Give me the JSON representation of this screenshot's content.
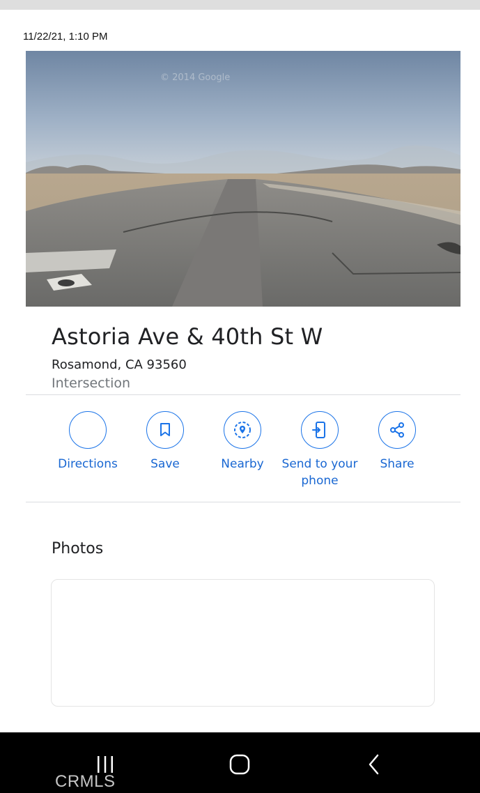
{
  "status": {
    "timestamp": "11/22/21, 1:10 PM"
  },
  "photo": {
    "watermark": "© 2014 Google"
  },
  "place": {
    "title": "Astoria Ave & 40th St W",
    "address": "Rosamond, CA 93560",
    "type": "Intersection"
  },
  "actions": [
    {
      "label": "Directions",
      "icon": "directions-icon"
    },
    {
      "label": "Save",
      "icon": "bookmark-icon"
    },
    {
      "label": "Nearby",
      "icon": "nearby-icon"
    },
    {
      "label": "Send to your phone",
      "icon": "send-to-phone-icon"
    },
    {
      "label": "Share",
      "icon": "share-icon"
    }
  ],
  "photos": {
    "heading": "Photos"
  },
  "navbar": {
    "buttons": [
      "recent-apps-icon",
      "home-icon",
      "back-icon"
    ]
  },
  "overlay": {
    "watermark": "CRMLS"
  },
  "colors": {
    "accent": "#1a73e8",
    "accent_text": "#1967d2",
    "secondary_text": "#70757a",
    "primary_text": "#202124",
    "navbar": "#000000"
  }
}
